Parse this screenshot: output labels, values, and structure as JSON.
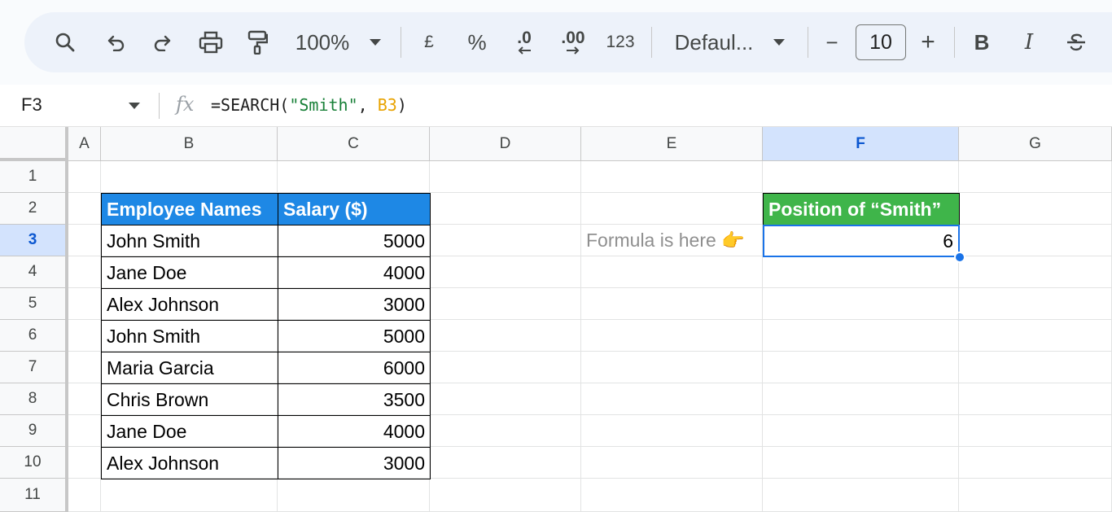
{
  "toolbar": {
    "zoom": "100%",
    "currency_label": "£",
    "percent_label": "%",
    "decrease_decimal_label": ".0",
    "increase_decimal_label": ".00",
    "number_format_label": "123",
    "font_name": "Defaul...",
    "font_size": "10",
    "minus_label": "−",
    "plus_label": "+",
    "bold_label": "B",
    "italic_label": "I"
  },
  "formula_bar": {
    "cell_ref": "F3",
    "fx_label": "fx",
    "formula_prefix": "=SEARCH(",
    "formula_string": "\"Smith\"",
    "formula_sep": ", ",
    "formula_ref": "B3",
    "formula_suffix": ")"
  },
  "columns": [
    "A",
    "B",
    "C",
    "D",
    "E",
    "F",
    "G"
  ],
  "rows": [
    "1",
    "2",
    "3",
    "4",
    "5",
    "6",
    "7",
    "8",
    "9",
    "10",
    "11"
  ],
  "selected": {
    "column": "F",
    "row": "3"
  },
  "table": {
    "headers": [
      "Employee Names",
      "Salary ($)"
    ],
    "rows": [
      [
        "John Smith",
        "5000"
      ],
      [
        "Jane Doe",
        "4000"
      ],
      [
        "Alex Johnson",
        "3000"
      ],
      [
        "John Smith",
        "5000"
      ],
      [
        "Maria Garcia",
        "6000"
      ],
      [
        "Chris Brown",
        "3500"
      ],
      [
        "Jane Doe",
        "4000"
      ],
      [
        "Alex Johnson",
        "3000"
      ]
    ]
  },
  "result": {
    "header": "Position of “Smith”",
    "value": "6",
    "note": "Formula is here 👉"
  },
  "colors": {
    "table_header": "#1e88e5",
    "result_header": "#3fb54a",
    "selection": "#1a73e8"
  }
}
